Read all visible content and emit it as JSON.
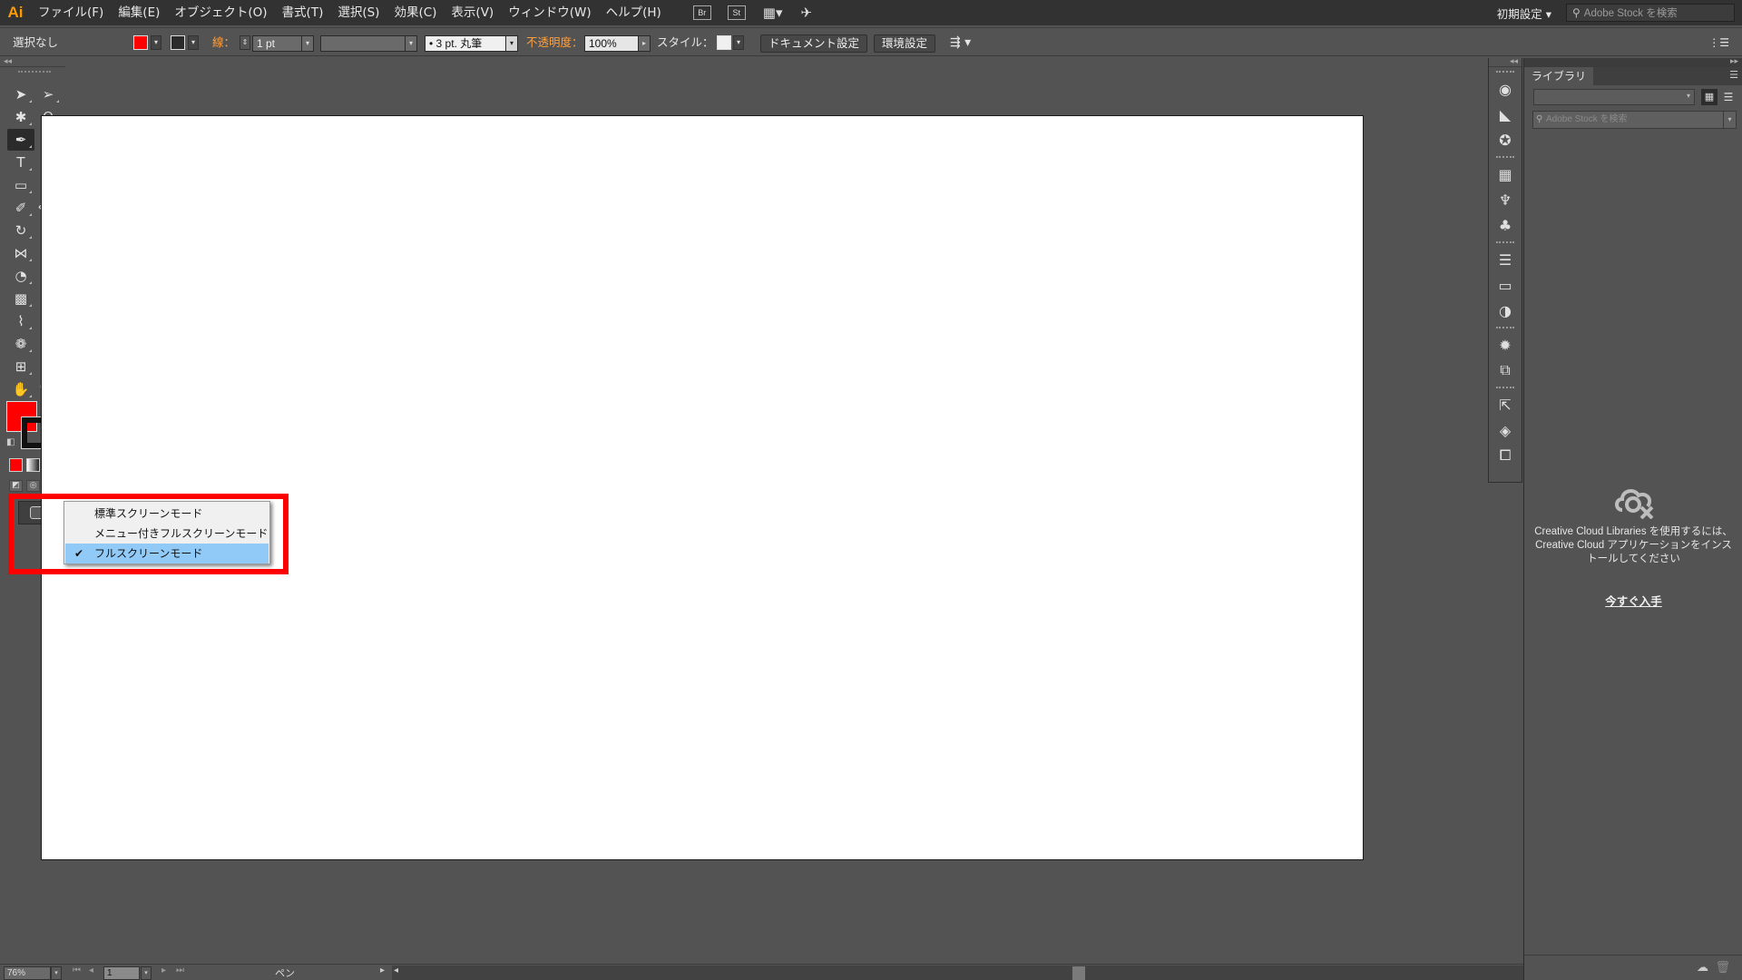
{
  "menubar": {
    "logo": "Ai",
    "items": [
      "ファイル(F)",
      "編集(E)",
      "オブジェクト(O)",
      "書式(T)",
      "選択(S)",
      "効果(C)",
      "表示(V)",
      "ウィンドウ(W)",
      "ヘルプ(H)"
    ],
    "bridge_label": "Br",
    "stock_label": "St",
    "workspace_label": "初期設定",
    "stock_search_placeholder": "Adobe Stock を検索"
  },
  "controlbar": {
    "selection_status": "選択なし",
    "fill_color": "#ff0000",
    "stroke_label": "線：",
    "stroke_weight": "1 pt",
    "brush_label": "3 pt. 丸筆",
    "opacity_label": "不透明度：",
    "opacity_value": "100%",
    "style_label": "スタイル：",
    "document_setup_button": "ドキュメント設定",
    "preferences_button": "環境設定"
  },
  "toolbar": {
    "tools": [
      {
        "name": "selection-tool",
        "glyph": "➤",
        "active": false
      },
      {
        "name": "direct-selection-tool",
        "glyph": "➢",
        "active": false
      },
      {
        "name": "magic-wand-tool",
        "glyph": "✱",
        "active": false
      },
      {
        "name": "lasso-tool",
        "glyph": "ᘯ",
        "active": false
      },
      {
        "name": "pen-tool",
        "glyph": "✒",
        "active": true
      },
      {
        "name": "curvature-tool",
        "glyph": "✎",
        "active": false
      },
      {
        "name": "type-tool",
        "glyph": "T",
        "active": false
      },
      {
        "name": "line-segment-tool",
        "glyph": "╱",
        "active": false
      },
      {
        "name": "rectangle-tool",
        "glyph": "▭",
        "active": false
      },
      {
        "name": "paintbrush-tool",
        "glyph": "🖌",
        "active": false
      },
      {
        "name": "shaper-tool",
        "glyph": "✐",
        "active": false
      },
      {
        "name": "eraser-tool",
        "glyph": "⌫",
        "active": false
      },
      {
        "name": "rotate-tool",
        "glyph": "↻",
        "active": false
      },
      {
        "name": "scale-tool",
        "glyph": "⤢",
        "active": false
      },
      {
        "name": "width-tool",
        "glyph": "⋈",
        "active": false
      },
      {
        "name": "free-transform-tool",
        "glyph": "⬚",
        "active": false
      },
      {
        "name": "shape-builder-tool",
        "glyph": "◔",
        "active": false
      },
      {
        "name": "perspective-grid-tool",
        "glyph": "▦",
        "active": false
      },
      {
        "name": "mesh-tool",
        "glyph": "▩",
        "active": false
      },
      {
        "name": "gradient-tool",
        "glyph": "▮",
        "active": false
      },
      {
        "name": "eyedropper-tool",
        "glyph": "⌇",
        "active": false
      },
      {
        "name": "blend-tool",
        "glyph": "◎",
        "active": false
      },
      {
        "name": "symbol-sprayer-tool",
        "glyph": "❁",
        "active": false
      },
      {
        "name": "column-graph-tool",
        "glyph": "▥",
        "active": false
      },
      {
        "name": "artboard-tool",
        "glyph": "⊞",
        "active": false
      },
      {
        "name": "slice-tool",
        "glyph": "⟋",
        "active": false
      },
      {
        "name": "hand-tool",
        "glyph": "✋",
        "active": false
      },
      {
        "name": "zoom-tool",
        "glyph": "🔍",
        "active": false
      }
    ],
    "fill_color": "#ff0000",
    "stroke_color": "#111111"
  },
  "screen_mode_menu": {
    "items": [
      {
        "label": "標準スクリーンモード",
        "checked": false
      },
      {
        "label": "メニュー付きフルスクリーンモード",
        "checked": false
      },
      {
        "label": "フルスクリーンモード",
        "checked": true
      }
    ],
    "highlight_color": "#ff0000"
  },
  "dock": {
    "groups": [
      [
        "color-guide-icon",
        "brushes-icon",
        "symbols-icon"
      ],
      [
        "swatches-grid-icon",
        "brush-library-icon",
        "club-symbol-icon"
      ],
      [
        "stroke-icon",
        "gradient-icon",
        "transparency-icon"
      ],
      [
        "appearance-icon",
        "graphic-styles-icon"
      ],
      [
        "export-icon",
        "layers-icon",
        "artboards-icon"
      ]
    ],
    "glyphs": {
      "color-guide-icon": "◉",
      "brushes-icon": "◣",
      "symbols-icon": "✪",
      "swatches-grid-icon": "▦",
      "brush-library-icon": "♆",
      "club-symbol-icon": "♣",
      "stroke-icon": "☰",
      "gradient-icon": "▭",
      "transparency-icon": "◑",
      "appearance-icon": "✹",
      "graphic-styles-icon": "⧉",
      "export-icon": "⇱",
      "layers-icon": "◈",
      "artboards-icon": "⧠"
    }
  },
  "libraries_panel": {
    "tab_label": "ライブラリ",
    "search_placeholder": "Adobe Stock を検索",
    "message": "Creative Cloud Libraries を使用するには、Creative Cloud アプリケーションをインストールしてください",
    "link_label": "今すぐ入手"
  },
  "statusbar": {
    "zoom": "76%",
    "page": "1",
    "tool": "ペン"
  }
}
